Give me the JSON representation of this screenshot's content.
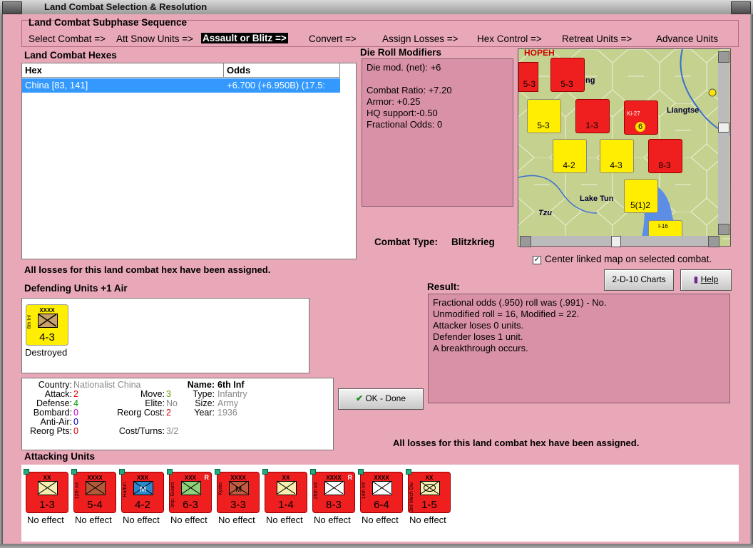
{
  "window": {
    "title": "Land Combat Selection & Resolution"
  },
  "subphase": {
    "title": "Land Combat Subphase Sequence",
    "steps": [
      "Select Combat =>",
      "Att Snow Units =>",
      "Assault or Blitz =>",
      "Convert =>",
      "Assign Losses =>",
      "Hex Control =>",
      "Retreat Units =>",
      "Advance Units"
    ],
    "active_index": 2
  },
  "hexes": {
    "title": "Land Combat Hexes",
    "columns": [
      "Hex",
      "Odds"
    ],
    "rows": [
      {
        "hex": "China [83, 141]",
        "odds": "+6.700 (+6.950B) (17.5:"
      }
    ]
  },
  "drm": {
    "title": "Die Roll Modifiers",
    "lines": [
      "Die mod. (net): +6",
      "",
      "Combat Ratio: +7.20",
      "Armor: +0.25",
      "HQ support:-0.50",
      "Fractional Odds: 0"
    ]
  },
  "combat_type": {
    "label": "Combat Type:",
    "value": "Blitzkrieg"
  },
  "center_map": {
    "label": "Center linked map on selected combat.",
    "checked": true
  },
  "losses_msg": "All losses for this land combat hex have been assigned.",
  "buttons": {
    "charts": "2-D-10 Charts",
    "help": "Help",
    "ok": "OK - Done"
  },
  "defending": {
    "title": "Defending Units +1 Air",
    "units": [
      {
        "name": "6th Inf",
        "size": "XXXX",
        "value": "4-3",
        "status": "Destroyed",
        "color": "#ffee00"
      }
    ]
  },
  "result": {
    "title": "Result:",
    "lines": [
      "Fractional odds (.950) roll was (.991)  - No.",
      "Unmodified roll = 16, Modified = 22.",
      "Attacker loses 0 units.",
      "Defender loses 1 unit.",
      "A breakthrough occurs."
    ]
  },
  "info": {
    "country_label": "Country:",
    "country": "Nationalist China",
    "attack_label": "Attack:",
    "attack": "2",
    "defense_label": "Defense:",
    "defense": "4",
    "bombard_label": "Bombard:",
    "bombard": "0",
    "antiair_label": "Anti-Air:",
    "antiair": "0",
    "reorgpts_label": "Reorg Pts:",
    "reorgpts": "0",
    "move_label": "Move:",
    "move": "3",
    "elite_label": "Elite:",
    "elite": "No",
    "reorgcost_label": "Reorg Cost:",
    "reorgcost": "2",
    "costturns_label": "Cost/Turns:",
    "costturns": "3/2",
    "name_label": "Name:",
    "name": "6th Inf",
    "type_label": "Type:",
    "type": "Infantry",
    "size_label": "Size:",
    "size": "Army",
    "year_label": "Year:",
    "year": "1936"
  },
  "attacking": {
    "title": "Attacking Units",
    "units": [
      {
        "size": "XX",
        "name": "",
        "value": "1-3",
        "status": "No effect",
        "r": ""
      },
      {
        "size": "XXXX",
        "name": "12th Inf",
        "value": "5-4",
        "status": "No effect",
        "r": ""
      },
      {
        "size": "XXX",
        "name": "Harbin",
        "value": "4-2",
        "status": "No effect",
        "r": ""
      },
      {
        "size": "XXX",
        "name": "Imp. Guard",
        "value": "6-3",
        "status": "No effect",
        "r": "R"
      },
      {
        "size": "XXXX",
        "name": "Kyoto",
        "value": "3-3",
        "status": "No effect",
        "r": ""
      },
      {
        "size": "XX",
        "name": "",
        "value": "1-4",
        "status": "No effect",
        "r": ""
      },
      {
        "size": "XXXX",
        "name": "25th Inf",
        "value": "8-3",
        "status": "No effect",
        "r": "R"
      },
      {
        "size": "XXXX",
        "name": "14th Inf",
        "value": "6-4",
        "status": "No effect",
        "r": ""
      },
      {
        "size": "XX",
        "name": "3rd Mech Div",
        "value": "1-5",
        "status": "No effect",
        "r": ""
      }
    ]
  },
  "map": {
    "labels": [
      "HOPEH",
      "Liangtse",
      "Lake Tun",
      "Tzu",
      "ng"
    ],
    "counters": [
      "5-3",
      "5-3",
      "1-3",
      "6",
      "4-2",
      "4-3",
      "8-3",
      "5(1)2",
      "Ki-27",
      "I-16"
    ]
  },
  "colors": {
    "panel": "#e8a8b8",
    "red_unit": "#ef1f1f",
    "yellow_unit": "#ffee00",
    "selection": "#3399ff"
  }
}
